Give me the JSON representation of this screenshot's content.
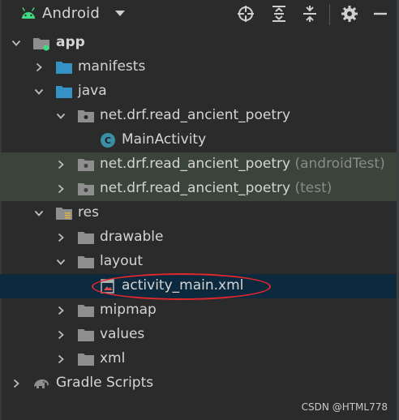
{
  "header": {
    "view_name": "Android",
    "icons": [
      "android-icon",
      "dropdown-icon",
      "locate-icon",
      "expand-all-icon",
      "collapse-all-icon",
      "gear-icon",
      "minimize-icon"
    ]
  },
  "tree": {
    "app": "app",
    "manifests": "manifests",
    "java": "java",
    "pkg_main": "net.drf.read_ancient_poetry",
    "main_activity": "MainActivity",
    "pkg_android_test": "net.drf.read_ancient_poetry",
    "pkg_android_test_suffix": "(androidTest)",
    "pkg_test": "net.drf.read_ancient_poetry",
    "pkg_test_suffix": "(test)",
    "res": "res",
    "drawable": "drawable",
    "layout": "layout",
    "activity_main": "activity_main.xml",
    "mipmap": "mipmap",
    "values": "values",
    "xml": "xml",
    "gradle_scripts": "Gradle Scripts"
  },
  "colors": {
    "background": "#2b2b2b",
    "test_row_bg": "#3b443a",
    "selected_row_bg": "#0d293e",
    "folder_blue": "#3592c4",
    "annotation_red": "#e0272c"
  },
  "watermark": "CSDN @HTML778"
}
